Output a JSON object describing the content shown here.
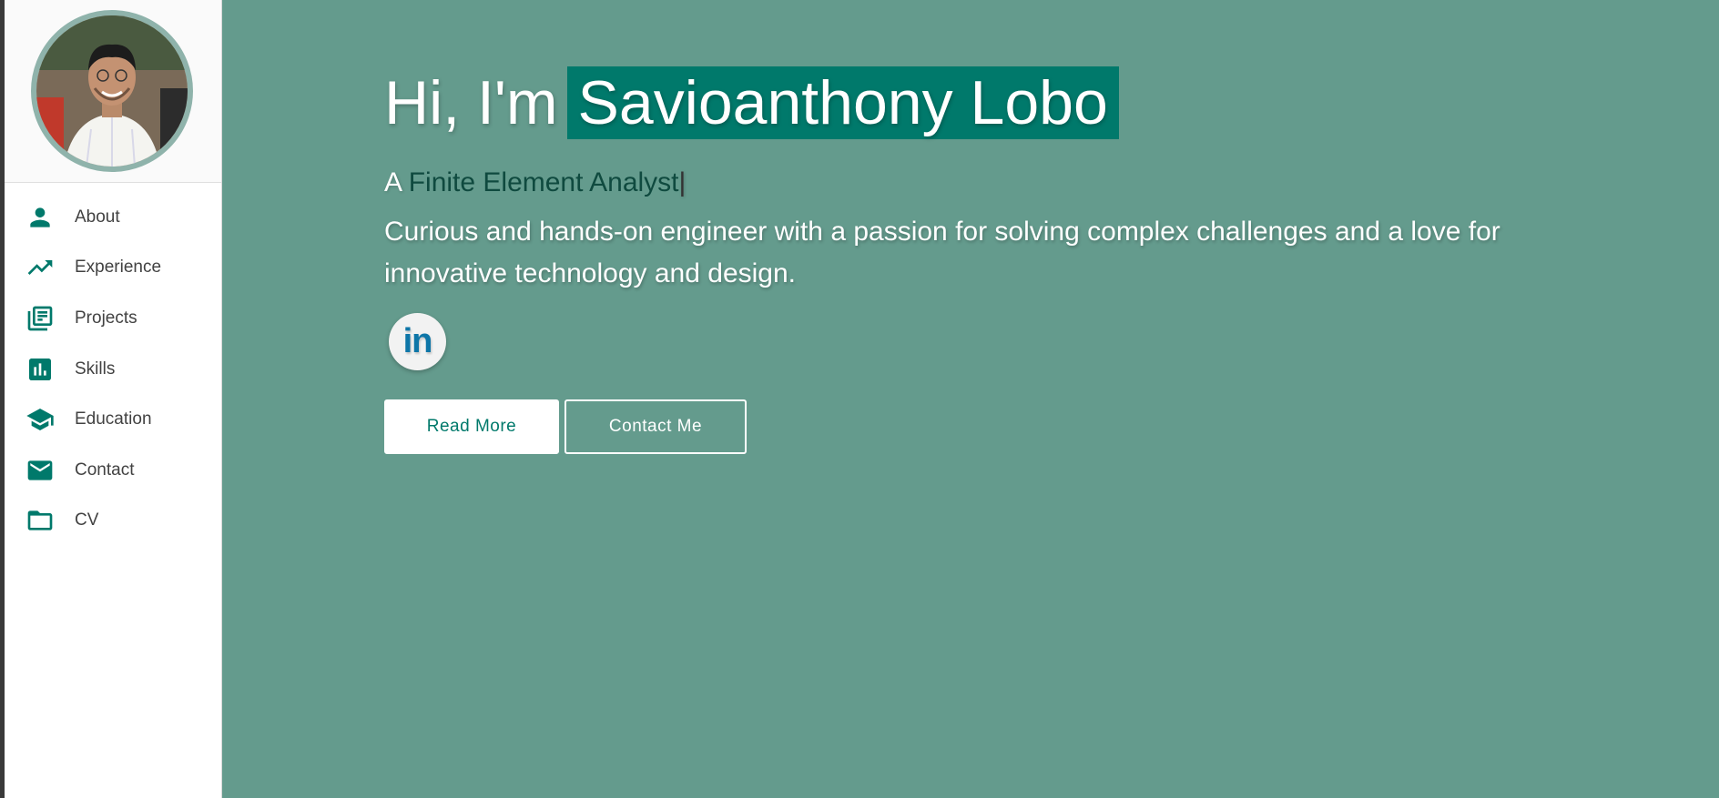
{
  "sidebar": {
    "items": [
      {
        "label": "About",
        "icon": "person-icon"
      },
      {
        "label": "Experience",
        "icon": "trending-up-icon"
      },
      {
        "label": "Projects",
        "icon": "library-books-icon"
      },
      {
        "label": "Skills",
        "icon": "bar-chart-icon"
      },
      {
        "label": "Education",
        "icon": "school-icon"
      },
      {
        "label": "Contact",
        "icon": "mail-icon"
      },
      {
        "label": "CV",
        "icon": "folder-icon"
      }
    ]
  },
  "hero": {
    "greeting_prefix": "Hi, I'm",
    "name": "Savioanthony Lobo",
    "role_prefix": "A",
    "role": "Finite Element Analyst",
    "role_cursor": "|",
    "tagline": "Curious and hands-on engineer with a passion for solving complex challenges and a love for innovative technology and design.",
    "social_linkedin": "in",
    "read_more_label": "Read More",
    "contact_label": "Contact Me"
  },
  "colors": {
    "accent": "#00796b",
    "main_background": "#649b8d",
    "avatar_ring": "#8fb3ab"
  }
}
